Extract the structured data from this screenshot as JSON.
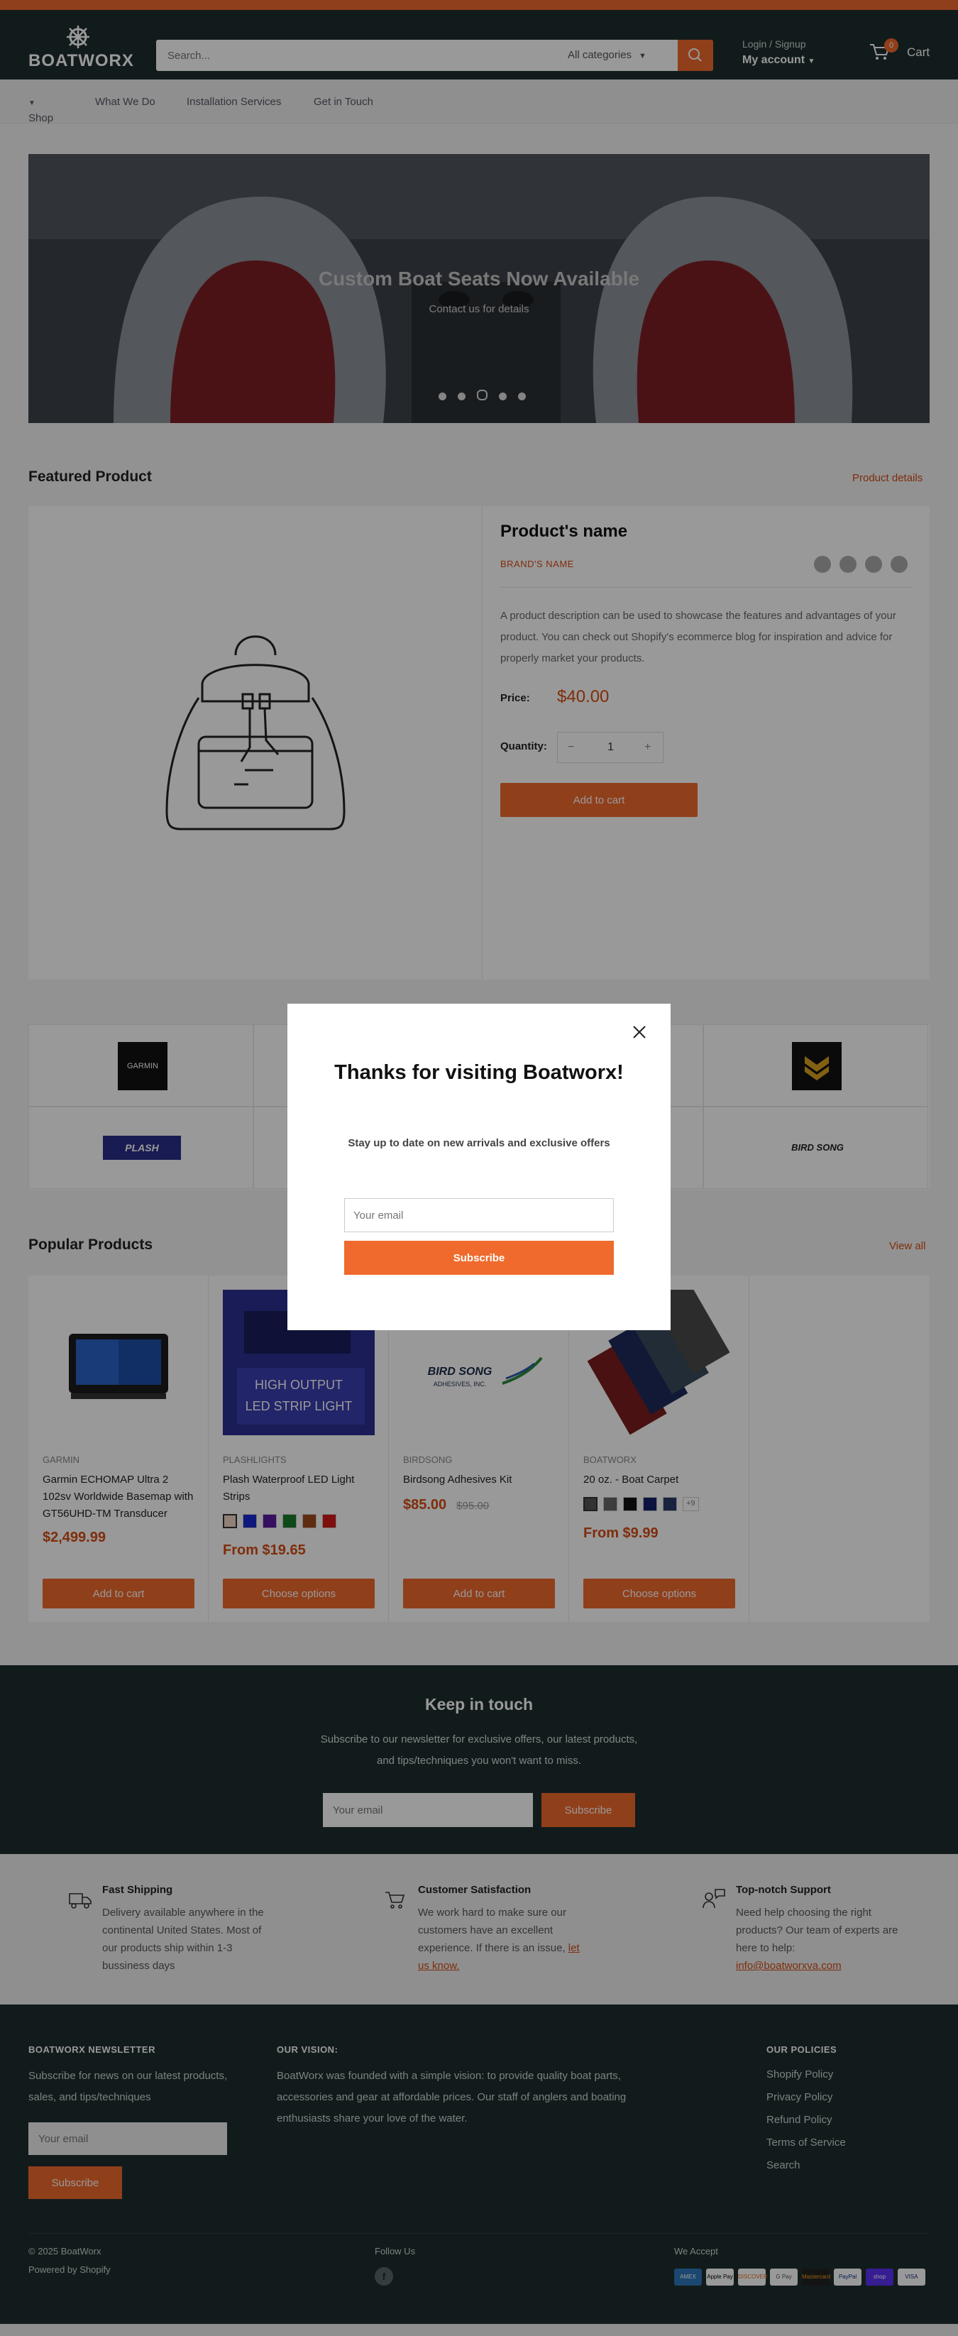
{
  "header": {
    "logo_text": "BOATWORX",
    "search_placeholder": "Search...",
    "category_select": "All categories",
    "account_line1": "Login / Signup",
    "account_line2": "My account",
    "cart_count": "0",
    "cart_label": "Cart"
  },
  "nav": [
    "Shop",
    "What We Do",
    "Installation Services",
    "Get in Touch"
  ],
  "hero": {
    "title": "Custom Boat Seats Now Available",
    "subtitle": "Contact us for details",
    "slides": 5,
    "active_slide": 2
  },
  "featured": {
    "section_title": "Featured Product",
    "link": "Product details",
    "name": "Product's name",
    "brand": "BRAND'S NAME",
    "description": "A product description can be used to showcase the features and advantages of your product. You can check out Shopify's ecommerce blog for inspiration and advice for properly market your products.",
    "price_label": "Price:",
    "price": "$40.00",
    "quantity_label": "Quantity:",
    "quantity": "1",
    "add_to_cart": "Add to cart"
  },
  "brands": {
    "garmin": "GARMIN",
    "plash": "PLASH",
    "birdsong": "BIRD SONG"
  },
  "popular": {
    "section_title": "Popular Products",
    "link": "View all",
    "products": [
      {
        "vendor": "GARMIN",
        "title": "Garmin ECHOMAP Ultra 2 102sv Worldwide Basemap with GT56UHD-TM Transducer",
        "price": "$2,499.99",
        "button": "Add to cart"
      },
      {
        "vendor": "PLASHLIGHTS",
        "title": "Plash Waterproof LED Light Strips",
        "price": "From $19.65",
        "button": "Choose options"
      },
      {
        "vendor": "BIRDSONG",
        "title": "Birdsong Adhesives Kit",
        "price": "$85.00",
        "compare_price": "$95.00",
        "button": "Add to cart"
      },
      {
        "vendor": "BOATWORX",
        "title": "20 oz. - Boat Carpet",
        "price": "From $9.99",
        "more_swatches": "+9",
        "button": "Choose options"
      }
    ],
    "plash_image_text": {
      "line1": "HIGH OUTPUT",
      "line2": "LED STRIP LIGHT"
    },
    "birdsong_image_text": {
      "line1": "BIRD SONG",
      "line2": "ADHESIVES, INC."
    }
  },
  "keep_in_touch": {
    "title": "Keep in touch",
    "text": "Subscribe to our newsletter for exclusive offers, our latest products, and tips/techniques you won't want to miss.",
    "placeholder": "Your email",
    "button": "Subscribe"
  },
  "features": [
    {
      "title": "Fast Shipping",
      "text": "Delivery available anywhere in the continental United States. Most of our products ship within 1-3 bussiness days"
    },
    {
      "title": "Customer Satisfaction",
      "text": "We work hard to make sure our customers have an excellent experience. If there is an issue,",
      "link": "let us know."
    },
    {
      "title": "Top-notch Support",
      "text": "Need help choosing the right products? Our team of experts are here to help:",
      "link": "info@boatworxva.com"
    }
  ],
  "footer": {
    "newsletter_title": "BOATWORX NEWSLETTER",
    "newsletter_text": "Subscribe for news on our latest products, sales, and tips/techniques",
    "placeholder": "Your email",
    "button": "Subscribe",
    "vision_title": "OUR VISION:",
    "vision_text": "BoatWorx was founded with a simple vision: to provide quality boat parts, accessories and gear at affordable prices. Our staff of anglers and boating enthusiasts share your love of the water.",
    "policies_title": "OUR POLICIES",
    "policies": [
      "Shopify Policy",
      "Privacy Policy",
      "Refund Policy",
      "Terms of Service",
      "Search"
    ],
    "copyright": "© 2025 BoatWorx",
    "powered": "Powered by Shopify",
    "follow": "Follow Us",
    "accept": "We Accept",
    "payments": [
      "AMEX",
      "Apple Pay",
      "DISCOVER",
      "G Pay",
      "Mastercard",
      "PayPal",
      "shop",
      "VISA"
    ]
  },
  "modal": {
    "title": "Thanks for visiting Boatworx!",
    "text": "Stay up to date on new arrivals and exclusive offers",
    "placeholder": "Your email",
    "button": "Subscribe"
  },
  "colors": {
    "accent": "#f06a2d",
    "dark": "#1e2d2d",
    "price": "#d44c13"
  }
}
